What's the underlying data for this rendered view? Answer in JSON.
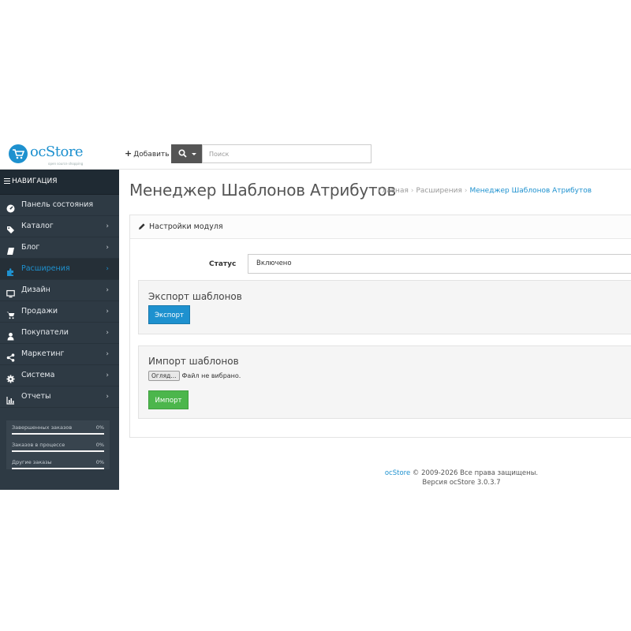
{
  "header": {
    "logo_text": "ocStore",
    "logo_tagline": "open source shopping",
    "add_label": "Добавить",
    "search_placeholder": "Поиск"
  },
  "sidebar": {
    "nav_title": "НАВИГАЦИЯ",
    "items": [
      {
        "label": "Панель состояния",
        "icon": "dashboard-icon",
        "has_children": false,
        "active": false
      },
      {
        "label": "Каталог",
        "icon": "tags-icon",
        "has_children": true,
        "active": false
      },
      {
        "label": "Блог",
        "icon": "book-icon",
        "has_children": true,
        "active": false
      },
      {
        "label": "Расширения",
        "icon": "puzzle-icon",
        "has_children": true,
        "active": true
      },
      {
        "label": "Дизайн",
        "icon": "monitor-icon",
        "has_children": true,
        "active": false
      },
      {
        "label": "Продажи",
        "icon": "cart-icon",
        "has_children": true,
        "active": false
      },
      {
        "label": "Покупатели",
        "icon": "user-icon",
        "has_children": true,
        "active": false
      },
      {
        "label": "Маркетинг",
        "icon": "share-icon",
        "has_children": true,
        "active": false
      },
      {
        "label": "Система",
        "icon": "cog-icon",
        "has_children": true,
        "active": false
      },
      {
        "label": "Отчеты",
        "icon": "bar-chart-icon",
        "has_children": true,
        "active": false
      }
    ],
    "stats": [
      {
        "label": "Завершенных заказов",
        "value": "0%",
        "progress": 0
      },
      {
        "label": "Заказов в процессе",
        "value": "0%",
        "progress": 0
      },
      {
        "label": "Другие заказы",
        "value": "0%",
        "progress": 0
      }
    ]
  },
  "page": {
    "title": "Менеджер Шаблонов Атрибутов",
    "breadcrumb": [
      "Главная",
      "Расширения",
      "Менеджер Шаблонов Атрибутов"
    ]
  },
  "panel": {
    "heading": "Настройки модуля",
    "status_label": "Статус",
    "status_value": "Включено",
    "export": {
      "title": "Экспорт шаблонов",
      "button": "Экспорт"
    },
    "import": {
      "title": "Импорт шаблонов",
      "file_button": "Огляд...",
      "file_status": "Файл не вибрано.",
      "button": "Импорт"
    }
  },
  "footer": {
    "brand_link": "ocStore",
    "copyright": "© 2009-2026 Все права защищены.",
    "version": "Версия ocStore 3.0.3.7"
  },
  "colors": {
    "accent": "#1e91cf",
    "success": "#4cb64c",
    "sidebar_bg": "#2e3a44"
  }
}
